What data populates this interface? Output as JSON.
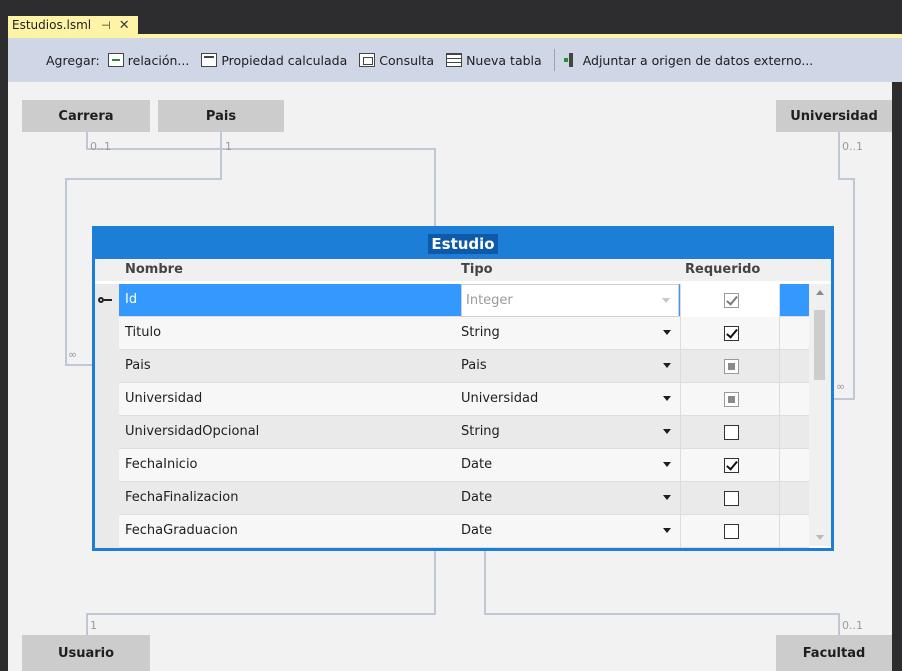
{
  "document_tab": {
    "title": "Estudios.lsml",
    "pin_glyph": "⊣",
    "close_glyph": "✕"
  },
  "toolbar": {
    "add_label": "Agregar:",
    "buttons": [
      {
        "icon": "relation-icon",
        "label": "relación..."
      },
      {
        "icon": "computed-property-icon",
        "label": "Propiedad calculada"
      },
      {
        "icon": "query-icon",
        "label": "Consulta"
      },
      {
        "icon": "new-table-icon",
        "label": "Nueva tabla"
      },
      {
        "icon": "attach-external-icon",
        "label": "Adjuntar a origen de datos externo..."
      }
    ]
  },
  "entities": {
    "carrera": "Carrera",
    "pais": "Pais",
    "universidad": "Universidad",
    "usuario": "Usuario",
    "facultad": "Facultad"
  },
  "multiplicities": {
    "carrera": "0..1",
    "pais": "1",
    "universidad": "0..1",
    "left_many": "∞",
    "right_many": "∞",
    "usuario": "1",
    "facultad": "0..1"
  },
  "estudio": {
    "title": "Estudio",
    "columns": {
      "name": "Nombre",
      "type": "Tipo",
      "required": "Requerido"
    },
    "rows": [
      {
        "name": "Id",
        "type": "Integer",
        "required": "checked",
        "key": true,
        "selected": true
      },
      {
        "name": "Titulo",
        "type": "String",
        "required": "checked"
      },
      {
        "name": "Pais",
        "type": "Pais",
        "required": "indeterminate"
      },
      {
        "name": "Universidad",
        "type": "Universidad",
        "required": "indeterminate"
      },
      {
        "name": "UniversidadOpcional",
        "type": "String",
        "required": "unchecked"
      },
      {
        "name": "FechaInicio",
        "type": "Date",
        "required": "checked"
      },
      {
        "name": "FechaFinalizacion",
        "type": "Date",
        "required": "unchecked"
      },
      {
        "name": "FechaGraduacion",
        "type": "Date",
        "required": "unchecked"
      }
    ]
  },
  "colors": {
    "selection_blue": "#3399ff",
    "entity_border_blue": "#1c7ed6",
    "tab_yellow": "#fff4a6",
    "toolbar_bg": "#cfd6e5"
  }
}
